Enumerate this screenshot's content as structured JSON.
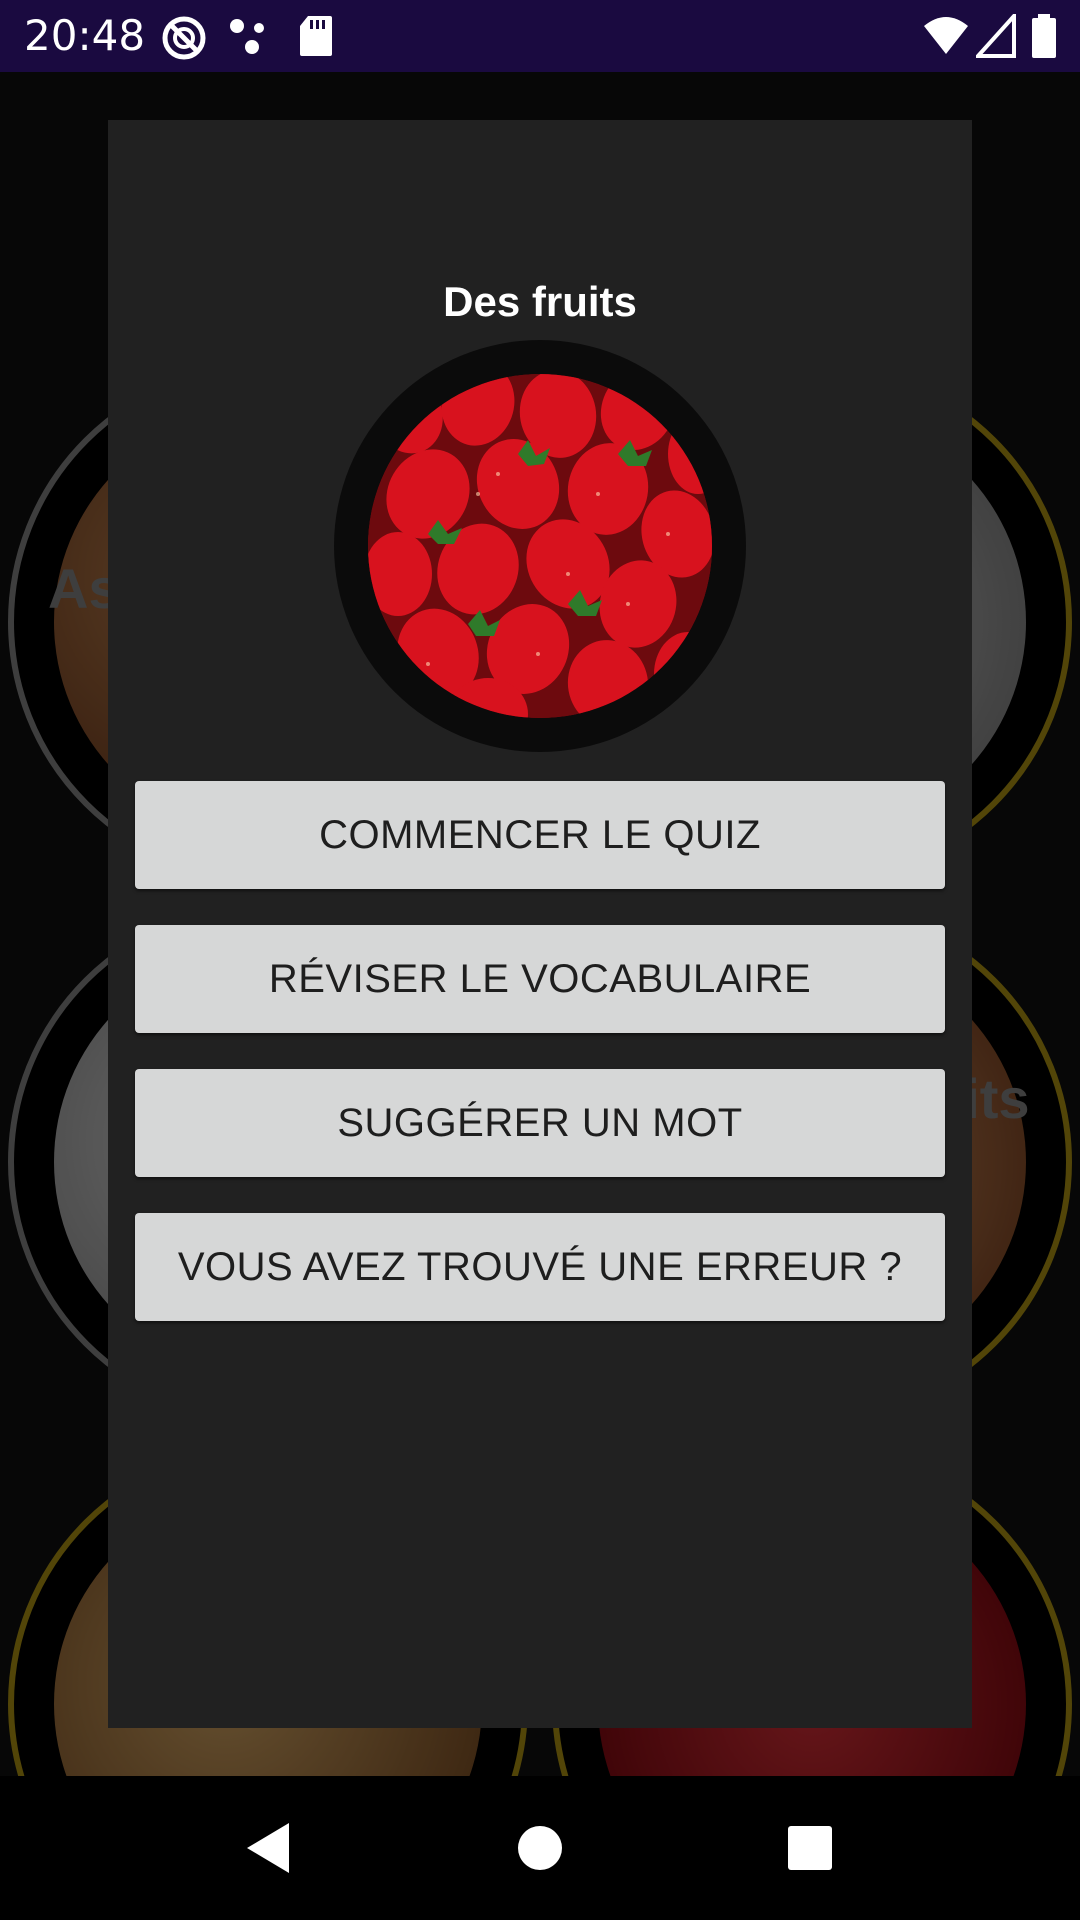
{
  "status_bar": {
    "time": "20:48",
    "icons_left": [
      "do-not-disturb-icon",
      "dots-icon",
      "sd-card-icon"
    ],
    "icons_right": [
      "wifi-icon",
      "signal-icon",
      "battery-icon"
    ]
  },
  "background": {
    "labels": [
      "As",
      "uits"
    ]
  },
  "dialog": {
    "title": "Des fruits",
    "image_icon": "strawberries-image",
    "buttons": {
      "start_quiz": "COMMENCER LE QUIZ",
      "review_vocab": "RÉVISER LE VOCABULAIRE",
      "suggest_word": "SUGGÉRER UN MOT",
      "report_error": "VOUS AVEZ TROUVÉ UNE ERREUR ?"
    }
  },
  "nav_bar": {
    "icons": [
      "back-icon",
      "home-icon",
      "recents-icon"
    ]
  },
  "colors": {
    "status_bar": "#1a0a40",
    "dialog_bg": "#212121",
    "button_bg": "#d6d7d7",
    "accent_ring": "#b59a12"
  }
}
